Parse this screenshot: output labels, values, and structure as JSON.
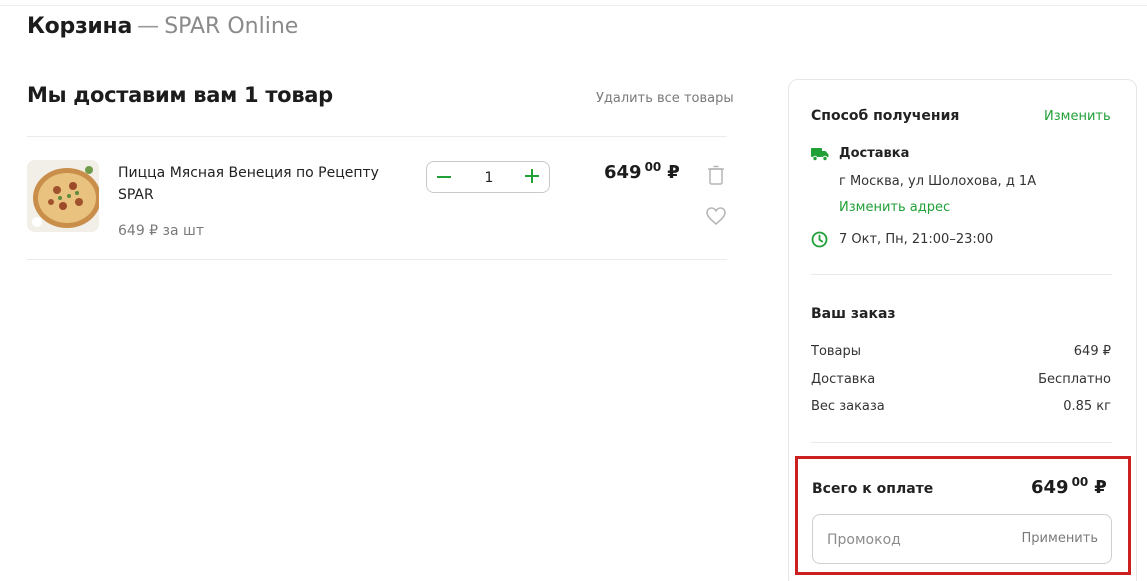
{
  "header": {
    "title": "Корзина",
    "dash": "—",
    "subtitle": "SPAR Online"
  },
  "cart": {
    "title": "Мы доставим вам 1 товар",
    "delete_all": "Удалить все товары",
    "items": [
      {
        "name": "Пицца Мясная Венеция по Рецепту SPAR",
        "unit_price": "649 ₽ за шт",
        "quantity": "1",
        "price_rub": "649",
        "price_kop": "00",
        "currency": "₽"
      }
    ]
  },
  "sidebar": {
    "receive_title": "Способ получения",
    "change": "Изменить",
    "delivery_type": "Доставка",
    "address": "г Москва, ул Шолохова, д 1А",
    "change_address": "Изменить адрес",
    "time_slot": "7 Окт, Пн, 21:00–23:00",
    "order_title": "Ваш заказ",
    "rows": [
      {
        "label": "Товары",
        "value": "649 ₽"
      },
      {
        "label": "Доставка",
        "value": "Бесплатно"
      },
      {
        "label": "Вес заказа",
        "value": "0.85 кг"
      }
    ],
    "total_label": "Всего к оплате",
    "total_rub": "649",
    "total_kop": "00",
    "currency": "₽",
    "promo_placeholder": "Промокод",
    "promo_apply": "Применить"
  },
  "colors": {
    "accent": "#21a038",
    "highlight": "#cc1f1f"
  },
  "icons": [
    "pizza-image",
    "minus-icon",
    "plus-icon",
    "trash-icon",
    "heart-icon",
    "truck-icon",
    "clock-icon"
  ]
}
